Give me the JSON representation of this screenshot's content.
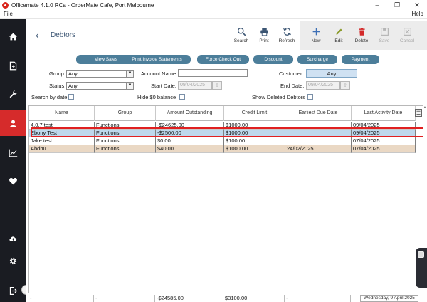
{
  "window": {
    "title": "Officemate 4.1.0 RCa - OrderMate Cafe, Port Melbourne",
    "minimize": "–",
    "maximize": "❐",
    "close": "✕"
  },
  "menubar": {
    "left": "File",
    "right": "Help"
  },
  "sidebar": {
    "items": [
      {
        "name": "home-icon"
      },
      {
        "name": "document-icon"
      },
      {
        "name": "wrench-icon"
      },
      {
        "name": "person-icon"
      },
      {
        "name": "chart-icon"
      },
      {
        "name": "heart-icon"
      },
      {
        "name": "cloud-upload-icon"
      },
      {
        "name": "gear-icon"
      },
      {
        "name": "logout-icon"
      }
    ],
    "active_color": "#d62b2b"
  },
  "resize_handle": "↔",
  "header": {
    "back": "‹",
    "title": "Debtors",
    "tools": {
      "search": "Search",
      "print": "Print",
      "refresh": "Refresh",
      "new": "New",
      "edit": "Edit",
      "delete": "Delete",
      "save": "Save",
      "cancel": "Cancel"
    }
  },
  "actions": [
    "View Sales",
    "Print Invoice Statements",
    "Force Check Out",
    "Discount",
    "Surcharge",
    "Payment"
  ],
  "filters": {
    "group_label": "Group:",
    "group_value": "Any",
    "account_label": "Account Name:",
    "account_value": "",
    "customer_label": "Customer:",
    "customer_value": "Any",
    "status_label": "Status:",
    "status_value": "Any",
    "start_label": "Start Date:",
    "start_value": "09/04/2025",
    "end_label": "End Date:",
    "end_value": "09/04/2025",
    "search_by_date": "Search by date",
    "hide_zero": "Hide $0 balance",
    "show_deleted": "Show Deleted Debtors"
  },
  "table": {
    "columns": [
      "Name",
      "Group",
      "Amount Outstanding",
      "Credit Limit",
      "Earliest Due Date",
      "Last Activity Date"
    ],
    "rows": [
      {
        "name": "4.0.7 test",
        "group": "Functions",
        "amount": "-$24625.00",
        "limit": "$1000.00",
        "due": "",
        "last": "09/04/2025",
        "style": "white"
      },
      {
        "name": "Ebony Test",
        "group": "Functions",
        "amount": "-$2500.00",
        "limit": "$1000.00",
        "due": "",
        "last": "09/04/2025",
        "style": "blue"
      },
      {
        "name": "Jake test",
        "group": "Functions",
        "amount": "$0.00",
        "limit": "$100.00",
        "due": "",
        "last": "07/04/2025",
        "style": "white"
      },
      {
        "name": "Ahdhu",
        "group": "Functions",
        "amount": "$40.00",
        "limit": "$1000.00",
        "due": "24/02/2025",
        "last": "07/04/2025",
        "style": "tan"
      }
    ],
    "totals": {
      "name": "-",
      "group": "-",
      "amount": "-$24585.00",
      "limit": "$3100.00",
      "due": "-"
    }
  },
  "status_date": "Wednesday, 9 April 2025",
  "colors": {
    "accent": "#4c7e9a",
    "selected_row": "#bed8ec",
    "tan_row": "#ead8c4",
    "highlight": "#e02020"
  }
}
